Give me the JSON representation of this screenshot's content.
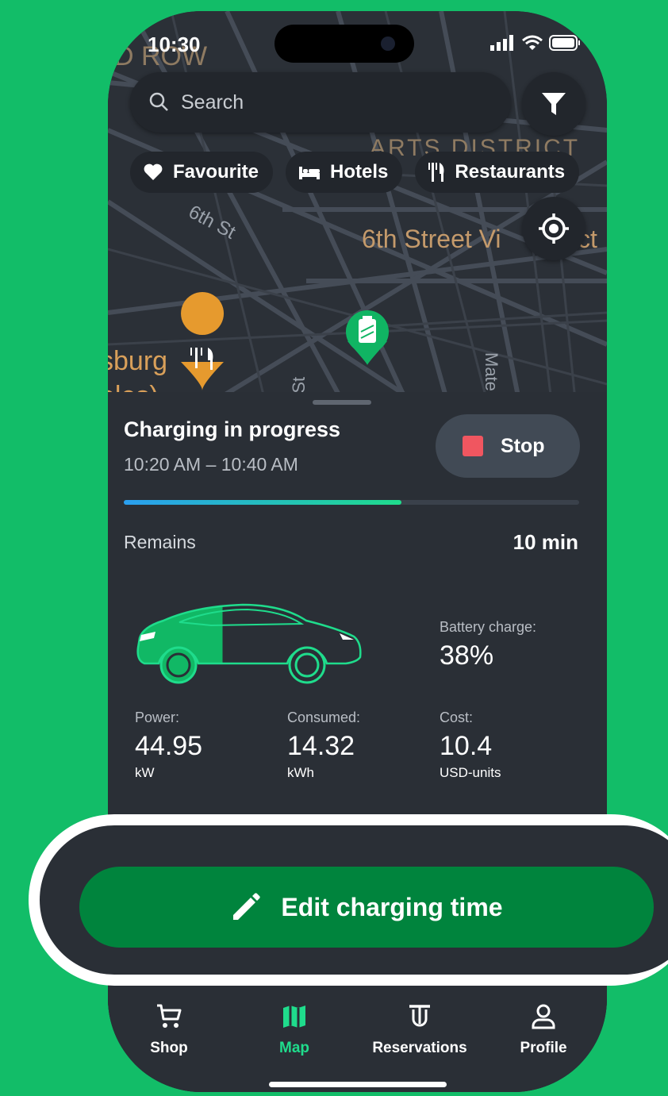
{
  "status": {
    "time": "10:30"
  },
  "map": {
    "labels": {
      "row": "D ROW",
      "arts": "ARTS DISTRICT",
      "sixth_st": "6th St",
      "sixth_village": "6th Street Vi",
      "village_tail": "ct",
      "burg": "sburg",
      "eles": "eles)",
      "a_st": "a St",
      "mate": "Mate"
    }
  },
  "search": {
    "placeholder": "Search"
  },
  "chips": [
    {
      "label": "Favourite",
      "icon": "heart-icon"
    },
    {
      "label": "Hotels",
      "icon": "bed-icon"
    },
    {
      "label": "Restaurants",
      "icon": "fork-knife-icon"
    }
  ],
  "session": {
    "title": "Charging in progress",
    "time_range": "10:20 AM – 10:40 AM",
    "stop_label": "Stop",
    "progress": 0.61,
    "remains_label": "Remains",
    "remains_value": "10 min"
  },
  "stats": {
    "battery": {
      "label": "Battery charge:",
      "value": "38%"
    },
    "power": {
      "label": "Power:",
      "value": "44.95",
      "unit": "kW"
    },
    "consumed": {
      "label": "Consumed:",
      "value": "14.32",
      "unit": "kWh"
    },
    "cost": {
      "label": "Cost:",
      "value": "10.4",
      "unit": "USD-units"
    }
  },
  "edit": {
    "label": "Edit charging time"
  },
  "tabs": [
    {
      "label": "Shop",
      "icon": "cart-icon"
    },
    {
      "label": "Map",
      "icon": "map-icon",
      "active": true
    },
    {
      "label": "Reservations",
      "icon": "reservation-icon"
    },
    {
      "label": "Profile",
      "icon": "person-icon"
    }
  ],
  "colors": {
    "background": "#12bd68",
    "accent": "#1fdc8c",
    "button": "#00843d",
    "stop": "#f05660"
  }
}
